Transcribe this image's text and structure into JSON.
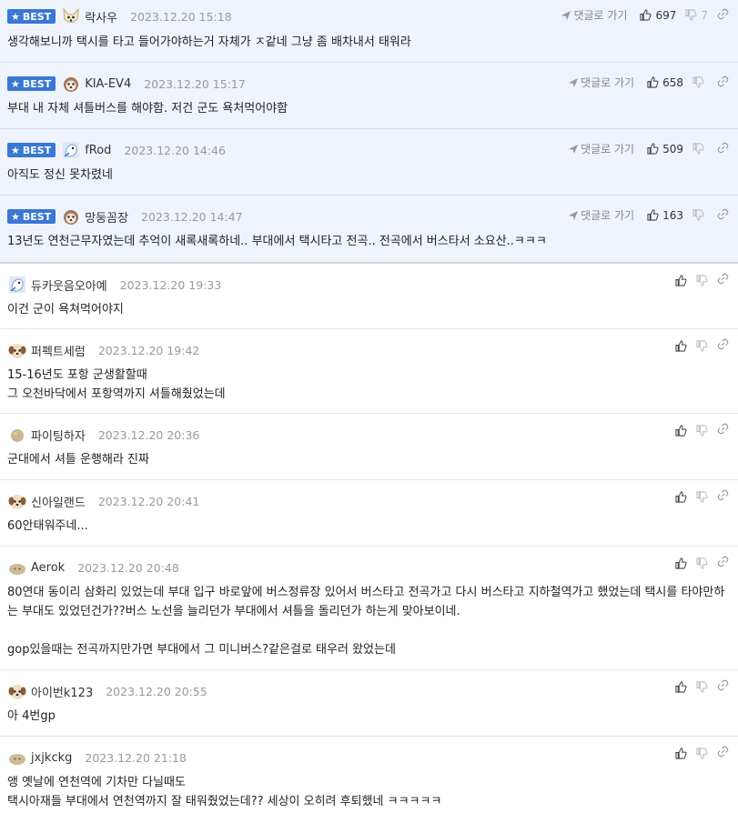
{
  "best_label": "BEST",
  "goto_label": "댓글로 가기",
  "comments": [
    {
      "best": true,
      "nick": "락사우",
      "date": "2023.12.20 15:18",
      "up": "697",
      "down": "7",
      "avatar": "dog-white-icon",
      "text": "생각해보니까 택시를 타고 들어가야하는거 자체가 ㅈ같네 그냥 좀 배차내서 태워라"
    },
    {
      "best": true,
      "nick": "KIA-EV4",
      "date": "2023.12.20 15:17",
      "up": "658",
      "down": "",
      "avatar": "dog-brown-icon",
      "text": "부대 내 자체 셔틀버스를 해야함. 저건 군도 욕처먹어야함"
    },
    {
      "best": true,
      "nick": "fRod",
      "date": "2023.12.20 14:46",
      "up": "509",
      "down": "",
      "avatar": "bird-blue-icon",
      "text": "아직도 정신 못차렸네"
    },
    {
      "best": true,
      "nick": "망둥꼼장",
      "date": "2023.12.20 14:47",
      "up": "163",
      "down": "",
      "avatar": "dog-brown-icon",
      "text": "13년도 연천근무자였는데 추억이 새록새록하네.. 부대에서 택시타고 전곡.. 전곡에서 버스타서 소요산..ㅋㅋㅋ"
    },
    {
      "best": false,
      "nick": "듀카웃음오아예",
      "date": "2023.12.20 19:33",
      "up": "",
      "down": "",
      "avatar": "bird-blue-icon",
      "text": "이건 군이 욕쳐먹어야지"
    },
    {
      "best": false,
      "nick": "퍼펙트세럼",
      "date": "2023.12.20 19:42",
      "up": "",
      "down": "",
      "avatar": "puppy-icon",
      "text": "15-16년도 포항 군생활할때\n그 오천바닥에서 포항역까지 셔틀해줬었는데"
    },
    {
      "best": false,
      "nick": "파이팅하자",
      "date": "2023.12.20 20:36",
      "up": "",
      "down": "",
      "avatar": "egg-icon",
      "text": "군대에서 셔틀 운행해라 진짜"
    },
    {
      "best": false,
      "nick": "신아일랜드",
      "date": "2023.12.20 20:41",
      "up": "",
      "down": "",
      "avatar": "puppy-icon",
      "text": "60안태워주네..."
    },
    {
      "best": false,
      "nick": "Aerok",
      "date": "2023.12.20 20:48",
      "up": "",
      "down": "",
      "avatar": "blob-icon",
      "text": "80연대 동이리 삼화리 있었는데 부대 입구 바로앞에 버스정류장 있어서 버스타고 전곡가고 다시 버스타고 지하철역가고 했었는데 택시를 타야만하는 부대도 있었던건가??버스 노선을 늘리던가 부대에서 셔틀을 돌리던가 하는게 맞아보이네.\n\ngop있을때는 전곡까지만가면 부대에서 그 미니버스?같은걸로 태우러 왔었는데"
    },
    {
      "best": false,
      "nick": "아이번k123",
      "date": "2023.12.20 20:55",
      "up": "",
      "down": "",
      "avatar": "puppy-icon",
      "text": "아 4번gp"
    },
    {
      "best": false,
      "nick": "jxjkckg",
      "date": "2023.12.20 21:18",
      "up": "",
      "down": "",
      "avatar": "blob-icon",
      "text": "앵 옛날에 연천역에 기차만 다닐때도\n택시아재들 부대에서 연천역까지 잘 태워줬었는데?? 세상이 오히려 후퇴했네 ㅋㅋㅋㅋㅋ"
    }
  ]
}
